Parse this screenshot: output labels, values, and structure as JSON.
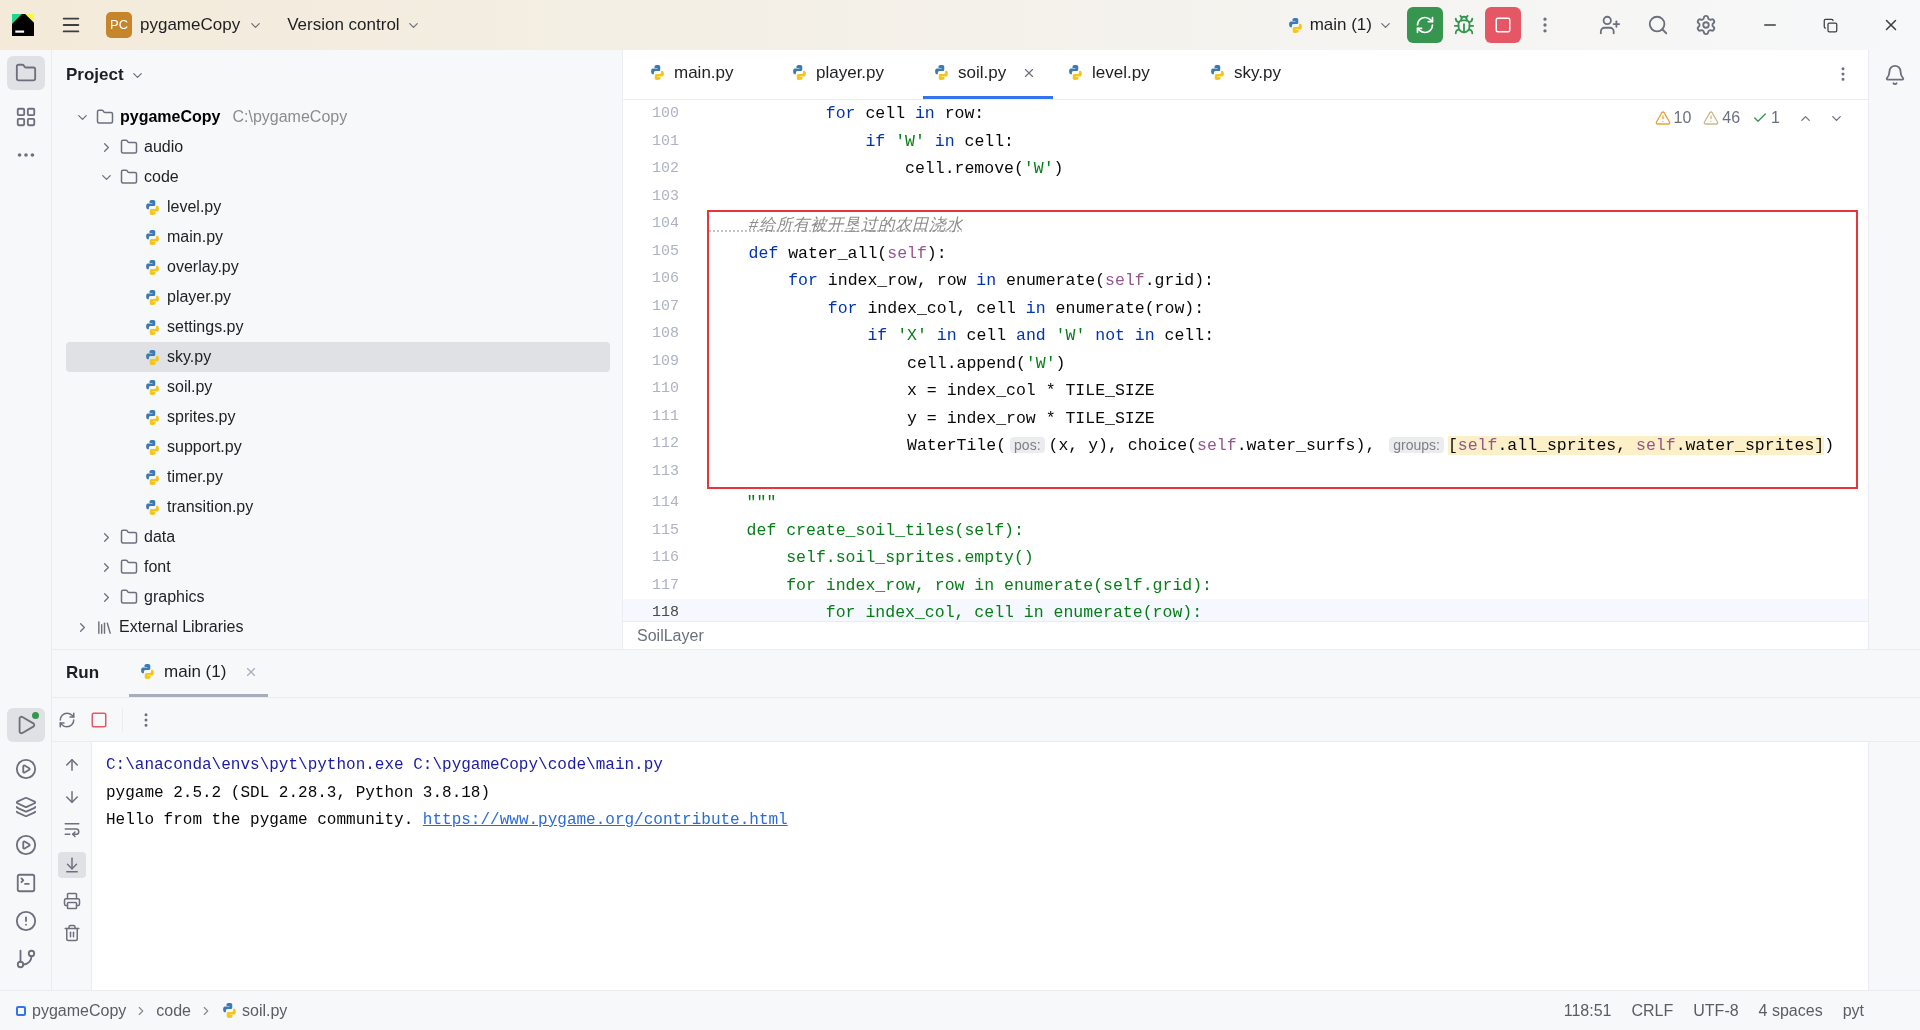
{
  "title_bar": {
    "logo": "PC",
    "project": "pygameCopy",
    "vcs": "Version control",
    "run_config": "main (1)"
  },
  "tool_window": {
    "title": "Project",
    "tree": [
      {
        "label": "pygameCopy",
        "path": "C:\\pygameCopy",
        "kind": "project",
        "expanded": true,
        "selected": false,
        "children": [
          {
            "label": "audio",
            "kind": "folder",
            "expanded": false,
            "selected": false
          },
          {
            "label": "code",
            "kind": "folder",
            "expanded": true,
            "selected": false,
            "children": [
              {
                "label": "level.py",
                "kind": "python",
                "selected": false
              },
              {
                "label": "main.py",
                "kind": "python",
                "selected": false
              },
              {
                "label": "overlay.py",
                "kind": "python",
                "selected": false
              },
              {
                "label": "player.py",
                "kind": "python",
                "selected": false
              },
              {
                "label": "settings.py",
                "kind": "python",
                "selected": false
              },
              {
                "label": "sky.py",
                "kind": "python",
                "selected": true
              },
              {
                "label": "soil.py",
                "kind": "python",
                "selected": false
              },
              {
                "label": "sprites.py",
                "kind": "python",
                "selected": false
              },
              {
                "label": "support.py",
                "kind": "python",
                "selected": false
              },
              {
                "label": "timer.py",
                "kind": "python",
                "selected": false
              },
              {
                "label": "transition.py",
                "kind": "python",
                "selected": false
              }
            ]
          },
          {
            "label": "data",
            "kind": "folder",
            "expanded": false,
            "selected": false
          },
          {
            "label": "font",
            "kind": "folder",
            "expanded": false,
            "selected": false
          },
          {
            "label": "graphics",
            "kind": "folder",
            "expanded": false,
            "selected": false
          }
        ]
      },
      {
        "label": "External Libraries",
        "kind": "library",
        "expanded": false,
        "selected": false
      }
    ]
  },
  "editor": {
    "tabs": [
      {
        "label": "main.py",
        "selected": false
      },
      {
        "label": "player.py",
        "selected": false
      },
      {
        "label": "soil.py",
        "selected": true
      },
      {
        "label": "level.py",
        "selected": false
      },
      {
        "label": "sky.py",
        "selected": false
      }
    ],
    "inspections": {
      "errors": "10",
      "warnings": "46",
      "typos": "1"
    },
    "sections": [
      {
        "framed": false,
        "lines": [
          {
            "number": "100",
            "current": false,
            "tokens": [
              {
                "text": "            for",
                "kind": "kw"
              },
              {
                "text": " cell ",
                "kind": "plain"
              },
              {
                "text": "in",
                "kind": "kw"
              },
              {
                "text": " row:",
                "kind": "plain"
              }
            ]
          },
          {
            "number": "101",
            "current": false,
            "tokens": [
              {
                "text": "                if ",
                "kind": "kw"
              },
              {
                "text": "'W'",
                "kind": "str"
              },
              {
                "text": " in",
                "kind": "kw"
              },
              {
                "text": " cell:",
                "kind": "plain"
              }
            ]
          },
          {
            "number": "102",
            "current": false,
            "tokens": [
              {
                "text": "                    cell.remove(",
                "kind": "plain"
              },
              {
                "text": "'W'",
                "kind": "str"
              },
              {
                "text": ")",
                "kind": "plain"
              }
            ]
          },
          {
            "number": "103",
            "current": false
          }
        ]
      },
      {
        "framed": true,
        "lines": [
          {
            "number": "104",
            "current": false,
            "tokens": [
              {
                "text": "    #给所有被开垦过的农田浇水",
                "kind": "comment"
              }
            ]
          },
          {
            "number": "105",
            "current": false,
            "tokens": [
              {
                "text": "    def",
                "kind": "kw"
              },
              {
                "text": " water_all(",
                "kind": "plain"
              },
              {
                "text": "self",
                "kind": "self"
              },
              {
                "text": "):",
                "kind": "plain"
              }
            ]
          },
          {
            "number": "106",
            "current": false,
            "tokens": [
              {
                "text": "        for",
                "kind": "kw"
              },
              {
                "text": " index_row, row ",
                "kind": "plain"
              },
              {
                "text": "in",
                "kind": "kw"
              },
              {
                "text": " enumerate(",
                "kind": "plain"
              },
              {
                "text": "self",
                "kind": "self"
              },
              {
                "text": ".grid):",
                "kind": "plain"
              }
            ]
          },
          {
            "number": "107",
            "current": false,
            "tokens": [
              {
                "text": "            for",
                "kind": "kw"
              },
              {
                "text": " index_col, cell ",
                "kind": "plain"
              },
              {
                "text": "in",
                "kind": "kw"
              },
              {
                "text": " enumerate(row):",
                "kind": "plain"
              }
            ]
          },
          {
            "number": "108",
            "current": false,
            "tokens": [
              {
                "text": "                if ",
                "kind": "kw"
              },
              {
                "text": "'X'",
                "kind": "str"
              },
              {
                "text": " in",
                "kind": "kw"
              },
              {
                "text": " cell ",
                "kind": "plain"
              },
              {
                "text": "and ",
                "kind": "kw"
              },
              {
                "text": "'W'",
                "kind": "str"
              },
              {
                "text": " not in",
                "kind": "kw"
              },
              {
                "text": " cell:",
                "kind": "plain"
              }
            ]
          },
          {
            "number": "109",
            "current": false,
            "tokens": [
              {
                "text": "                    cell.append(",
                "kind": "plain"
              },
              {
                "text": "'W'",
                "kind": "str"
              },
              {
                "text": ")",
                "kind": "plain"
              }
            ]
          },
          {
            "number": "110",
            "current": false,
            "tokens": [
              {
                "text": "                    x = index_col * TILE_SIZE",
                "kind": "plain"
              }
            ]
          },
          {
            "number": "111",
            "current": false,
            "tokens": [
              {
                "text": "                    y = index_row * TILE_SIZE",
                "kind": "plain"
              }
            ]
          },
          {
            "number": "112",
            "current": false,
            "tokens": [
              {
                "text": "                    WaterTile(",
                "kind": "plain"
              },
              {
                "text": "pos:",
                "kind": "hint"
              },
              {
                "text": "(x, y), choice(",
                "kind": "plain"
              },
              {
                "text": "self",
                "kind": "self"
              },
              {
                "text": ".water_surfs), ",
                "kind": "plain"
              },
              {
                "text": "groups:",
                "kind": "hint"
              },
              {
                "text": "[",
                "kind": "match"
              },
              {
                "text": "self",
                "kind": "match_self"
              },
              {
                "text": ".all_sprites, ",
                "kind": "match"
              },
              {
                "text": "self",
                "kind": "match_self"
              },
              {
                "text": ".water_sprites]",
                "kind": "match"
              },
              {
                "text": ")",
                "kind": "plain"
              }
            ]
          },
          {
            "number": "113",
            "current": false
          }
        ]
      },
      {
        "framed": false,
        "lines": [
          {
            "number": "114",
            "current": false,
            "tokens": [
              {
                "text": "    \"\"\"",
                "kind": "str"
              }
            ]
          },
          {
            "number": "115",
            "current": false,
            "tokens": [
              {
                "text": "    def create_soil_tiles(self):",
                "kind": "str"
              }
            ]
          },
          {
            "number": "116",
            "current": false,
            "tokens": [
              {
                "text": "        self.soil_sprites.empty()",
                "kind": "str"
              }
            ]
          },
          {
            "number": "117",
            "current": false,
            "tokens": [
              {
                "text": "        for index_row, row in enumerate(self.grid):",
                "kind": "str"
              }
            ]
          },
          {
            "number": "118",
            "current": true,
            "tokens": [
              {
                "text": "            for index_col, cell in enumerate(row):",
                "kind": "str"
              }
            ]
          }
        ]
      }
    ],
    "breadcrumb": "SoilLayer"
  },
  "run_panel": {
    "title": "Run",
    "tabs": [
      {
        "label": "main (1)",
        "selected": true
      }
    ],
    "console": [
      {
        "kind": "command",
        "text": "C:\\anaconda\\envs\\pyt\\python.exe C:\\pygameCopy\\code\\main.py"
      },
      {
        "kind": "output",
        "text": "pygame 2.5.2 (SDL 2.28.3, Python 3.8.18)"
      },
      {
        "kind": "output",
        "text": "Hello from the pygame community. ",
        "link": "https://www.pygame.org/contribute.html"
      }
    ]
  },
  "status_bar": {
    "path": [
      "pygameCopy",
      "code",
      "soil.py"
    ],
    "items": [
      "118:51",
      "CRLF",
      "UTF-8",
      "4 spaces",
      "pyt"
    ]
  }
}
